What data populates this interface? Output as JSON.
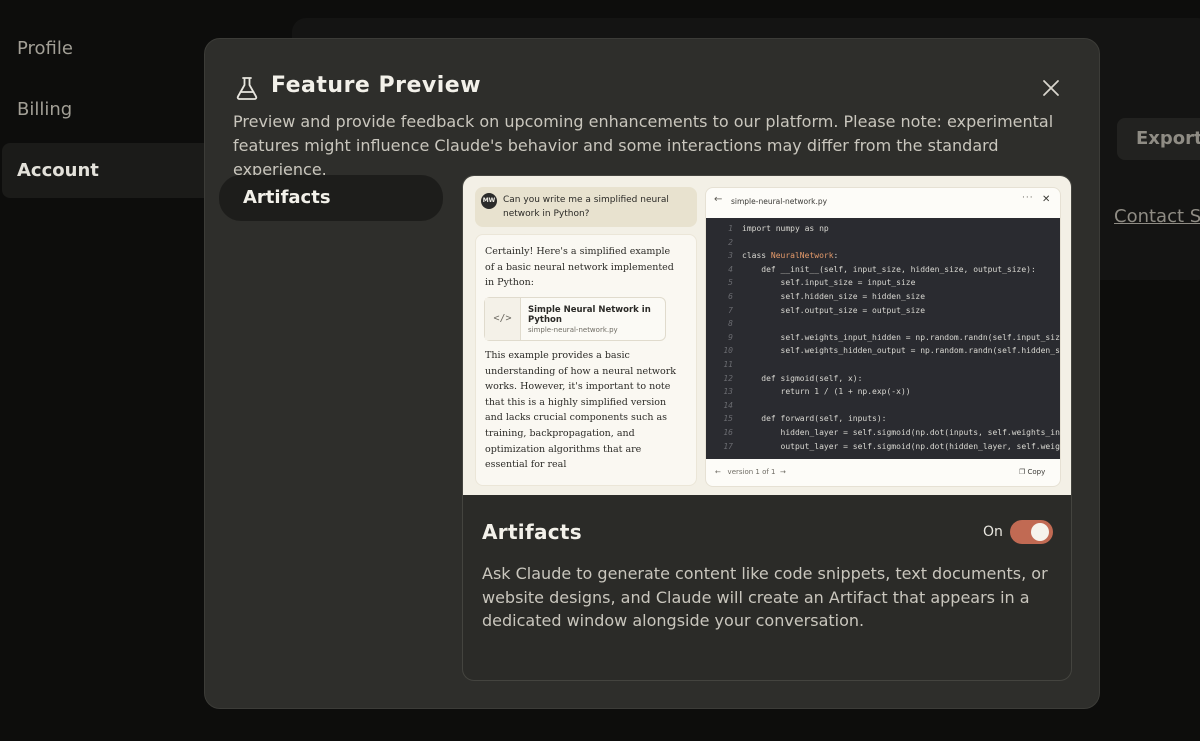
{
  "sidebar": {
    "items": [
      {
        "label": "Profile"
      },
      {
        "label": "Billing"
      },
      {
        "label": "Account"
      }
    ]
  },
  "background": {
    "export_label": "Export",
    "contact_label": "Contact S"
  },
  "modal": {
    "title": "Feature Preview",
    "description": "Preview and provide feedback on upcoming enhancements to our platform. Please note: experimental features might influence Claude's behavior and some interactions may differ from the standard experience.",
    "tabs": [
      {
        "label": "Artifacts"
      }
    ],
    "preview": {
      "user_avatar": "MW",
      "user_message": "Can you write me a simplified neural network in Python?",
      "assistant_intro": "Certainly! Here's a simplified example of a basic neural network implemented in Python:",
      "artifact_title": "Simple Neural Network in Python",
      "artifact_file": "simple-neural-network.py",
      "assistant_body": "This example provides a basic understanding of how a neural network works. However, it's important to note that this is a highly simplified version and lacks crucial components such as training, backpropagation, and optimization algorithms that are essential for real",
      "code_filename": "simple-neural-network.py",
      "code_more": "···",
      "code_lines": [
        {
          "n": "1",
          "pre": "import numpy as np",
          "cls": "",
          "post": ""
        },
        {
          "n": "2",
          "pre": "",
          "cls": "",
          "post": ""
        },
        {
          "n": "3",
          "pre": "class ",
          "cls": "NeuralNetwork",
          "post": ":"
        },
        {
          "n": "4",
          "pre": "    def __init__(self, input_size, hidden_size, output_size):",
          "cls": "",
          "post": ""
        },
        {
          "n": "5",
          "pre": "        self.input_size = input_size",
          "cls": "",
          "post": ""
        },
        {
          "n": "6",
          "pre": "        self.hidden_size = hidden_size",
          "cls": "",
          "post": ""
        },
        {
          "n": "7",
          "pre": "        self.output_size = output_size",
          "cls": "",
          "post": ""
        },
        {
          "n": "8",
          "pre": "",
          "cls": "",
          "post": ""
        },
        {
          "n": "9",
          "pre": "        self.weights_input_hidden = np.random.randn(self.input_size",
          "cls": "",
          "post": ""
        },
        {
          "n": "10",
          "pre": "        self.weights_hidden_output = np.random.randn(self.hidden_si",
          "cls": "",
          "post": ""
        },
        {
          "n": "11",
          "pre": "",
          "cls": "",
          "post": ""
        },
        {
          "n": "12",
          "pre": "    def sigmoid(self, x):",
          "cls": "",
          "post": ""
        },
        {
          "n": "13",
          "pre": "        return 1 / (1 + np.exp(-x))",
          "cls": "",
          "post": ""
        },
        {
          "n": "14",
          "pre": "",
          "cls": "",
          "post": ""
        },
        {
          "n": "15",
          "pre": "    def forward(self, inputs):",
          "cls": "",
          "post": ""
        },
        {
          "n": "16",
          "pre": "        hidden_layer = self.sigmoid(np.dot(inputs, self.weights_inp",
          "cls": "",
          "post": ""
        },
        {
          "n": "17",
          "pre": "        output_layer = self.sigmoid(np.dot(hidden_layer, self.weigh",
          "cls": "",
          "post": ""
        }
      ],
      "version_label": "version 1 of 1",
      "copy_label": "Copy"
    },
    "feature": {
      "title": "Artifacts",
      "toggle_label": "On",
      "toggle_on": true,
      "description": "Ask Claude to generate content like code snippets, text documents, or website designs, and Claude will create an Artifact that appears in a dedicated window alongside your conversation."
    }
  },
  "colors": {
    "accent": "#c16a53",
    "modal_bg": "#2e2e2b",
    "page_bg": "#0d0d0c"
  },
  "icons": {
    "title_icon": "flask-icon",
    "close_icon": "close-icon",
    "artifact_icon": "code-icon"
  }
}
